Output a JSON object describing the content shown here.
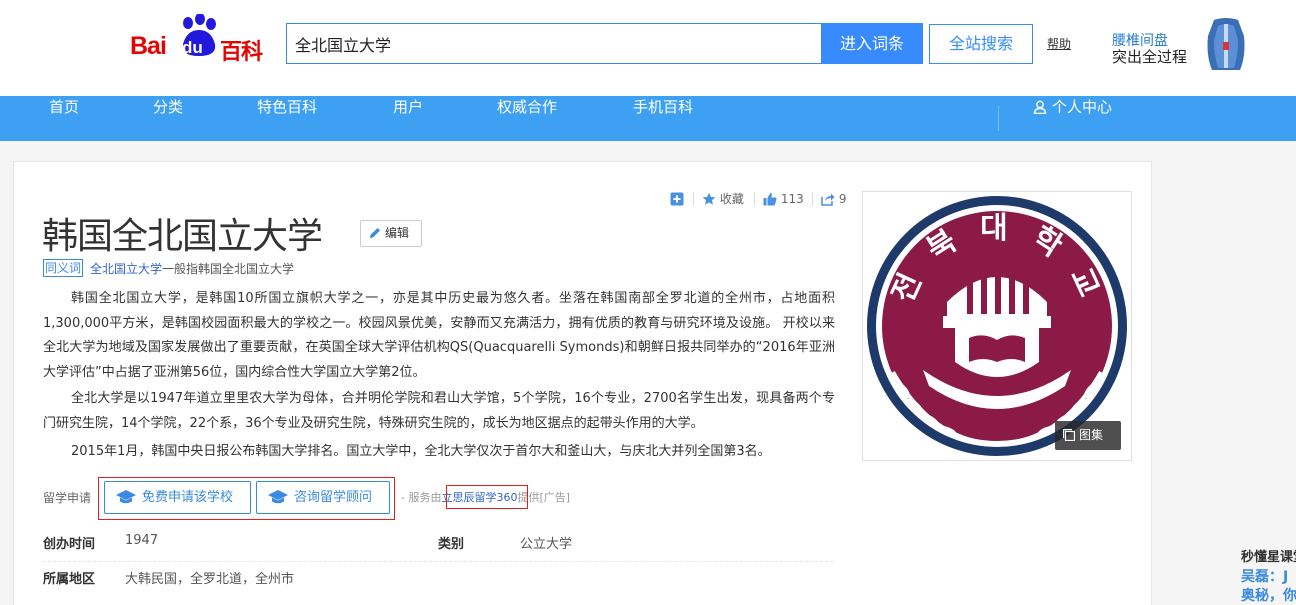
{
  "header": {
    "logo_bai": "Bai",
    "logo_du": "du",
    "logo_baike": "百科",
    "search_value": "全北国立大学",
    "enter_button": "进入词条",
    "site_search_button": "全站搜索",
    "help_link": "帮助",
    "ad_line1": "腰椎间盘",
    "ad_line2": "突出全过程"
  },
  "nav": {
    "items": [
      "首页",
      "分类",
      "特色百科",
      "用户",
      "权威合作",
      "手机百科"
    ],
    "user_center": "个人中心"
  },
  "tools": {
    "collect": "收藏",
    "likes": "113",
    "shares": "9"
  },
  "article": {
    "title": "韩国全北国立大学",
    "edit": "编辑",
    "synonym_tag": "同义词",
    "synonym_link": "全北国立大学",
    "synonym_rest": "一般指韩国全北国立大学",
    "paragraphs": [
      "韩国全北国立大学，是韩国10所国立旗帜大学之一，亦是其中历史最为悠久者。坐落在韩国南部全罗北道的全州市，占地面积1,300,000平方米，是韩国校园面积最大的学校之一。校园风景优美，安静而又充满活力，拥有优质的教育与研究环境及设施。 开校以来全北大学为地域及国家发展做出了重要贡献，在英国全球大学评估机构QS(Quacquarelli Symonds)和朝鲜日报共同举办的“2016年亚洲大学评估”中占据了亚洲第56位，国内综合性大学国立大学第2位。",
      "全北大学是以1947年道立里里农大学为母体，合并明伦学院和君山大学馆，5个学院，16个专业，2700名学生出发，现具备两个专门研究生院，14个学院，22个系，36个专业及研究生院，特殊研究生院的，成长为地区据点的起带头作用的大学。",
      "2015年1月，韩国中央日报公布韩国大学排名。国立大学中，全北大学仅次于首尔大和釜山大，与庆北大并列全国第3名。"
    ],
    "study_label": "留学申请",
    "study_btn1": "免费申请该学校",
    "study_btn2": "咨询留学顾问",
    "service_prefix": "- 服务由",
    "service_provider": "立思辰留学360",
    "service_suffix": "提供[广告]",
    "info": {
      "founded_key": "创办时间",
      "founded_val": "1947",
      "category_key": "类别",
      "category_val": "公立大学",
      "region_key": "所属地区",
      "region_val": "大韩民国，全罗北道，全州市"
    },
    "gallery": "图集",
    "emblem_text": "전 북 대 학 교"
  },
  "side": {
    "title": "秒懂星课堂",
    "line1": "吴磊：J",
    "line2": "奥秘，你"
  },
  "colors": {
    "nav_bg": "#3ea0f3",
    "accent": "#388bff",
    "brand_red": "#e10602",
    "emblem_maroon": "#8b1a47",
    "emblem_navy": "#1d3a6b"
  }
}
